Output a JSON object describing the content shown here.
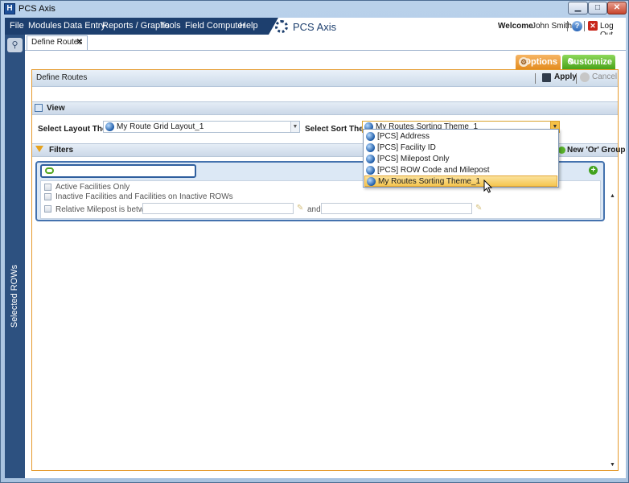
{
  "window": {
    "title": "PCS Axis"
  },
  "menubar": {
    "items": [
      "File",
      "Modules",
      "Data Entry",
      "Reports / Graphs",
      "Tools",
      "Field Computer",
      "Help"
    ],
    "app_name": "PCS Axis",
    "welcome_label": "Welcome",
    "user_name": "John Smith",
    "logout_label": "Log Out"
  },
  "sidebar": {
    "vertical_label": "Selected ROWs"
  },
  "tabs": [
    {
      "label": "Define Routes"
    }
  ],
  "toolbar": {
    "options_label": "Options",
    "customize_label": "Customize"
  },
  "panel": {
    "title": "Define Routes",
    "apply_label": "Apply",
    "cancel_label": "Cancel"
  },
  "view": {
    "title": "View",
    "layout_theme_label": "Select Layout Theme",
    "layout_theme_value": "My Route Grid Layout_1",
    "sort_theme_label": "Select Sort Theme",
    "sort_theme_value": "My Routes Sorting Theme_1"
  },
  "sort_dropdown": {
    "options": [
      "[PCS] Address",
      "[PCS] Facility ID",
      "[PCS] Milepost Only",
      "[PCS] ROW Code and Milepost",
      "My Routes Sorting Theme_1"
    ],
    "selected_index": 4
  },
  "filters": {
    "title": "Filters",
    "new_or_group_label": "New 'Or' Group",
    "active_facilities_label": "Active Facilities Only",
    "inactive_facilities_label": "Inactive Facilities and Facilities on Inactive ROWs",
    "relative_milepost_label": "Relative Milepost is between",
    "and_label": "and"
  },
  "colors": {
    "accent_orange": "#e59a2d",
    "menu_dark": "#1d3f6e",
    "customize_green": "#48a319"
  }
}
